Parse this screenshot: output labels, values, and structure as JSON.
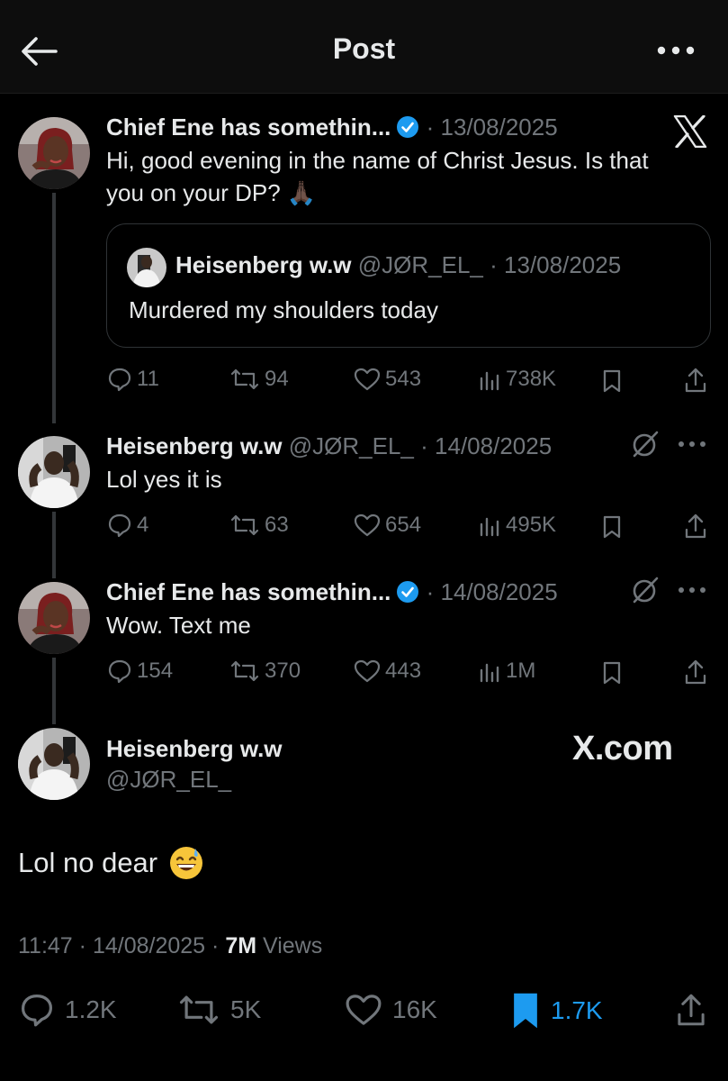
{
  "header": {
    "title": "Post"
  },
  "colors": {
    "accent": "#1d9bf0",
    "muted": "#71767b",
    "text": "#e7e9ea",
    "background": "#000000"
  },
  "tweets": [
    {
      "name": "Chief Ene has somethin...",
      "verified": true,
      "date": "13/08/2025",
      "text_line1": "Hi, good evening in the name of Christ Jesus. Is that",
      "text_line2": "you on your DP? 🙏🏿",
      "quote": {
        "name": "Heisenberg w.w",
        "handle": "@JØR_EL_",
        "date": "13/08/2025",
        "text": "Murdered my shoulders today"
      },
      "replies": "11",
      "reposts": "94",
      "likes": "543",
      "views": "738K"
    },
    {
      "name": "Heisenberg w.w",
      "handle": "@JØR_EL_",
      "date": "14/08/2025",
      "text": "Lol yes it is",
      "replies": "4",
      "reposts": "63",
      "likes": "654",
      "views": "495K"
    },
    {
      "name": "Chief Ene has somethin...",
      "verified": true,
      "date": "14/08/2025",
      "text": "Wow. Text me",
      "replies": "154",
      "reposts": "370",
      "likes": "443",
      "views": "1M"
    }
  ],
  "main": {
    "name": "Heisenberg w.w",
    "handle": "@JØR_EL_",
    "watermark": "X.com",
    "text": "Lol no dear",
    "time": "11:47",
    "date": "14/08/2025",
    "views": "7M",
    "views_label": "Views",
    "replies": "1.2K",
    "reposts": "5K",
    "likes": "16K",
    "bookmarks": "1.7K"
  }
}
